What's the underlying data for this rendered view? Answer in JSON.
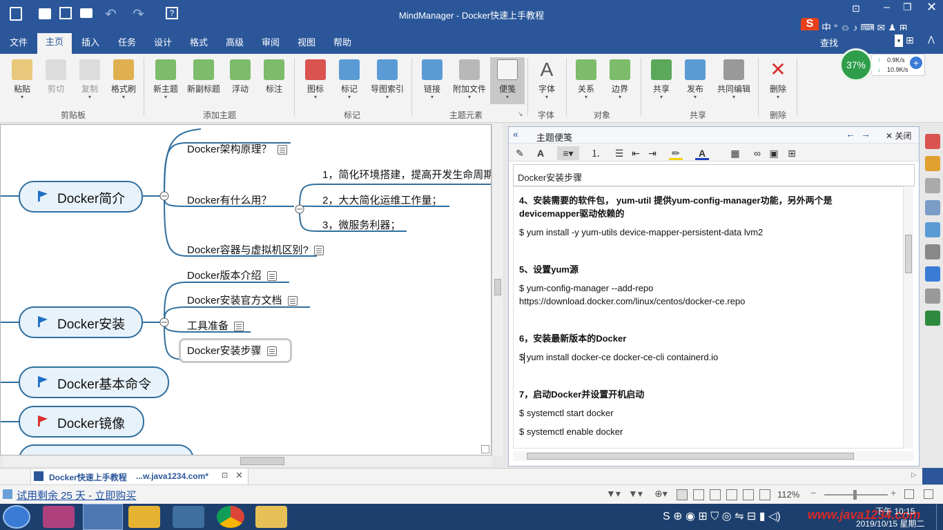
{
  "window": {
    "title": "MindManager - Docker快速上手教程"
  },
  "menu": {
    "items": [
      "文件",
      "主页",
      "插入",
      "任务",
      "设计",
      "格式",
      "高级",
      "审阅",
      "视图",
      "帮助"
    ],
    "active": "主页"
  },
  "search": {
    "label": "查找"
  },
  "net_widget": {
    "percent": "37%",
    "up": "0.9K/s",
    "down": "10.9K/s"
  },
  "ribbon": {
    "buttons": [
      "粘贴",
      "剪切",
      "复制",
      "格式刷",
      "新主题",
      "新副标题",
      "浮动",
      "标注",
      "图标",
      "标记",
      "导图索引",
      "链接",
      "附加文件",
      "便笺",
      "字体",
      "关系",
      "边界",
      "共享",
      "发布",
      "共同编辑",
      "删除"
    ],
    "groups": [
      "剪贴板",
      "添加主题",
      "标记",
      "主题元素",
      "字体",
      "对象",
      "共享",
      "删除"
    ]
  },
  "map": {
    "topics": [
      "Docker简介",
      "Docker安装",
      "Docker基本命令",
      "Docker镜像"
    ],
    "intro_subs": [
      "Docker架构原理？",
      "Docker有什么用？",
      "Docker容器与虚拟机区别?"
    ],
    "uses": [
      "1，简化环境搭建，提高开发生命周期",
      "2，大大简化运维工作量；",
      "3，微服务利器；"
    ],
    "install_subs": [
      "Docker版本介绍",
      "Docker安装官方文档",
      "工具准备",
      "Docker安装步骤"
    ]
  },
  "notes": {
    "header": "主题便笺",
    "close": "关闭",
    "topic_title": "Docker安装步骤",
    "lines": [
      "4、安装需要的软件包， yum-util 提供yum-config-manager功能，另外两个是",
      "devicemapper驱动依赖的",
      "$ yum install -y yum-utils device-mapper-persistent-data lvm2",
      "5、设置yum源",
      "$ yum-config-manager --add-repo",
      "https://download.docker.com/linux/centos/docker-ce.repo",
      "6，安装最新版本的Docker",
      "$ yum install docker-ce docker-ce-cli containerd.io",
      "7，启动Docker并设置开机启动",
      "$ systemctl start docker",
      "$ systemctl enable docker"
    ]
  },
  "tab": {
    "doc": "Docker快速上手教程",
    "url": "...w.java1234.com*"
  },
  "status": {
    "trial": "试用剩余 25 天 - 立即购买",
    "zoom": "112%"
  },
  "taskbar": {
    "time": "下午 10:15",
    "date": "2019/10/15 星期二",
    "watermark": "www.java1234.com"
  }
}
